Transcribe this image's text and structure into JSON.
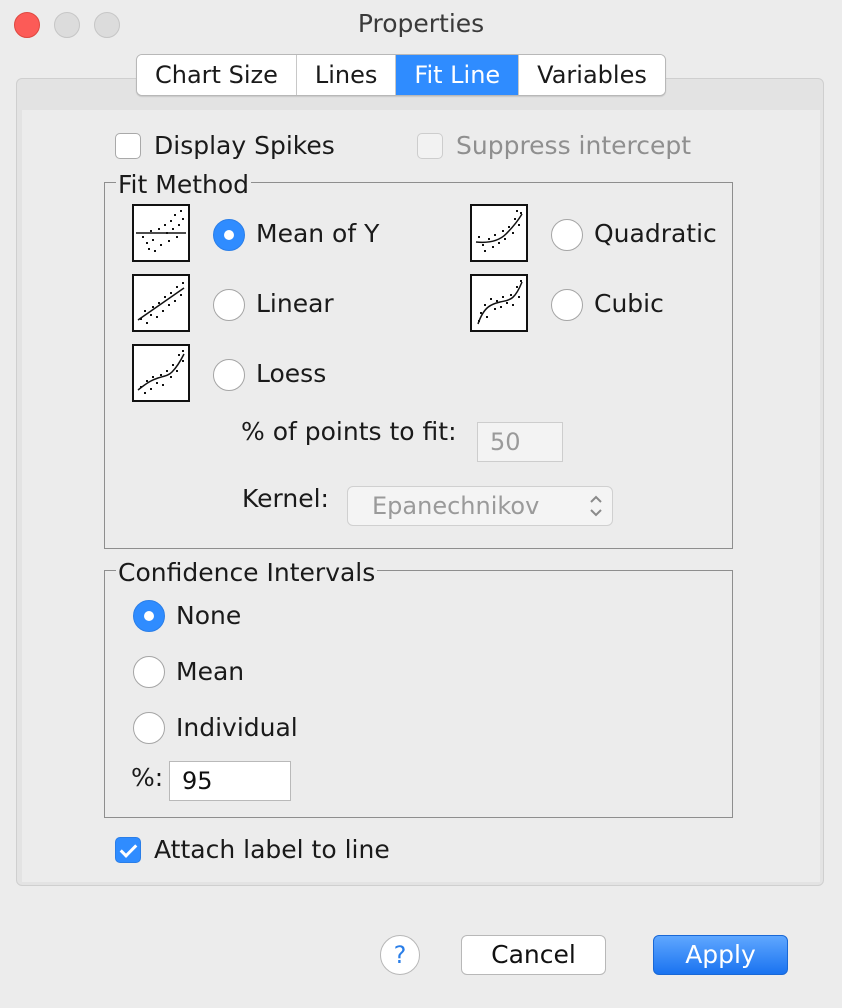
{
  "window": {
    "title": "Properties"
  },
  "tabs": [
    {
      "label": "Chart Size",
      "active": false
    },
    {
      "label": "Lines",
      "active": false
    },
    {
      "label": "Fit Line",
      "active": true
    },
    {
      "label": "Variables",
      "active": false
    }
  ],
  "options": {
    "display_spikes": {
      "label": "Display Spikes",
      "checked": false
    },
    "suppress_intercept": {
      "label": "Suppress intercept",
      "checked": false,
      "enabled": false
    }
  },
  "fit_method": {
    "title": "Fit Method",
    "selected": "Mean of Y",
    "options": {
      "mean_of_y": "Mean of Y",
      "linear": "Linear",
      "loess": "Loess",
      "quadratic": "Quadratic",
      "cubic": "Cubic"
    },
    "points_to_fit": {
      "label": "% of points to fit:",
      "value": "50"
    },
    "kernel": {
      "label": "Kernel:",
      "value": "Epanechnikov"
    }
  },
  "confidence_intervals": {
    "title": "Confidence Intervals",
    "selected": "None",
    "options": {
      "none": "None",
      "mean": "Mean",
      "individual": "Individual"
    },
    "percent": {
      "label": "%:",
      "value": "95"
    }
  },
  "attach_label": {
    "label": "Attach label to line",
    "checked": true
  },
  "buttons": {
    "help": "?",
    "cancel": "Cancel",
    "apply": "Apply"
  },
  "colors": {
    "accent": "#2f8cff",
    "close": "#fc5b57"
  }
}
